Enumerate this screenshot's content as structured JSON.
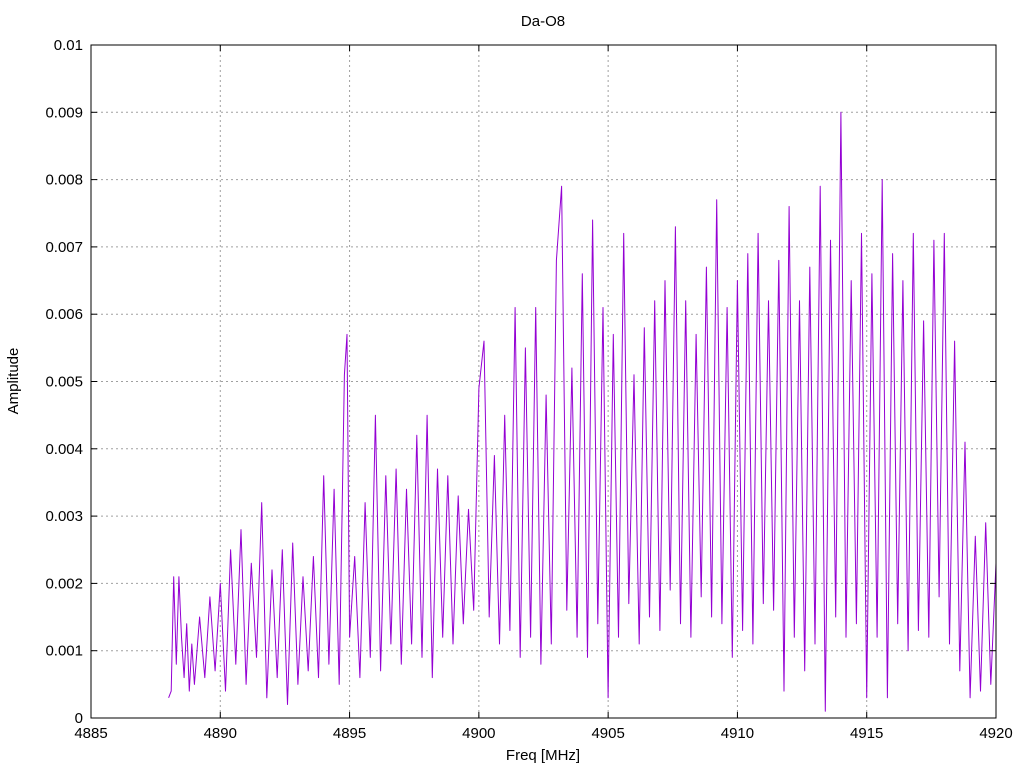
{
  "chart_data": {
    "type": "line",
    "title": "Da-O8",
    "xlabel": "Freq [MHz]",
    "ylabel": "Amplitude",
    "xlim": [
      4885,
      4920
    ],
    "ylim": [
      0,
      0.01
    ],
    "x_ticks": [
      "4885",
      "4890",
      "4895",
      "4900",
      "4905",
      "4910",
      "4915",
      "4920"
    ],
    "y_ticks": [
      "0",
      "0.001",
      "0.002",
      "0.003",
      "0.004",
      "0.005",
      "0.006",
      "0.007",
      "0.008",
      "0.009",
      "0.01"
    ],
    "grid": true,
    "series_color": "#9400d3",
    "series": [
      {
        "x": [
          4888.0,
          4888.1,
          4888.2,
          4888.3,
          4888.4,
          4888.5,
          4888.6,
          4888.7,
          4888.8,
          4888.9,
          4889.0,
          4889.2,
          4889.4,
          4889.6,
          4889.8,
          4890.0,
          4890.2,
          4890.4,
          4890.6,
          4890.8,
          4891.0,
          4891.2,
          4891.4,
          4891.6,
          4891.8,
          4892.0,
          4892.2,
          4892.4,
          4892.6,
          4892.8,
          4893.0,
          4893.2,
          4893.4,
          4893.6,
          4893.8,
          4894.0,
          4894.2,
          4894.4,
          4894.6,
          4894.8,
          4894.9,
          4895.0,
          4895.2,
          4895.4,
          4895.6,
          4895.8,
          4896.0,
          4896.2,
          4896.4,
          4896.6,
          4896.8,
          4897.0,
          4897.2,
          4897.4,
          4897.6,
          4897.8,
          4898.0,
          4898.2,
          4898.4,
          4898.6,
          4898.8,
          4899.0,
          4899.2,
          4899.4,
          4899.6,
          4899.8,
          4900.0,
          4900.2,
          4900.4,
          4900.6,
          4900.8,
          4901.0,
          4901.2,
          4901.4,
          4901.6,
          4901.8,
          4902.0,
          4902.2,
          4902.4,
          4902.6,
          4902.8,
          4903.0,
          4903.2,
          4903.4,
          4903.6,
          4903.8,
          4904.0,
          4904.2,
          4904.4,
          4904.6,
          4904.8,
          4905.0,
          4905.2,
          4905.4,
          4905.6,
          4905.8,
          4906.0,
          4906.2,
          4906.4,
          4906.6,
          4906.8,
          4907.0,
          4907.2,
          4907.4,
          4907.6,
          4907.8,
          4908.0,
          4908.2,
          4908.4,
          4908.6,
          4908.8,
          4909.0,
          4909.2,
          4909.4,
          4909.6,
          4909.8,
          4910.0,
          4910.2,
          4910.4,
          4910.6,
          4910.8,
          4911.0,
          4911.2,
          4911.4,
          4911.6,
          4911.8,
          4912.0,
          4912.2,
          4912.4,
          4912.6,
          4912.8,
          4913.0,
          4913.2,
          4913.4,
          4913.6,
          4913.8,
          4914.0,
          4914.2,
          4914.4,
          4914.6,
          4914.8,
          4915.0,
          4915.2,
          4915.4,
          4915.6,
          4915.8,
          4916.0,
          4916.2,
          4916.4,
          4916.6,
          4916.8,
          4917.0,
          4917.2,
          4917.4,
          4917.6,
          4917.8,
          4918.0,
          4918.2,
          4918.4,
          4918.6,
          4918.8,
          4919.0,
          4919.2,
          4919.4,
          4919.6,
          4919.8,
          4920.0
        ],
        "y": [
          0.0003,
          0.0004,
          0.0021,
          0.0008,
          0.0021,
          0.0012,
          0.0006,
          0.0014,
          0.0004,
          0.0011,
          0.0005,
          0.0015,
          0.0006,
          0.0018,
          0.0007,
          0.002,
          0.0004,
          0.0025,
          0.0008,
          0.0028,
          0.0005,
          0.0023,
          0.0009,
          0.0032,
          0.0003,
          0.0022,
          0.0006,
          0.0025,
          0.0002,
          0.0026,
          0.0005,
          0.0021,
          0.0007,
          0.0024,
          0.0006,
          0.0036,
          0.0008,
          0.0034,
          0.0005,
          0.0051,
          0.0057,
          0.0012,
          0.0024,
          0.0006,
          0.0032,
          0.0009,
          0.0045,
          0.0007,
          0.0036,
          0.0011,
          0.0037,
          0.0008,
          0.0034,
          0.0011,
          0.0042,
          0.0009,
          0.0045,
          0.0006,
          0.0037,
          0.0012,
          0.0036,
          0.0011,
          0.0033,
          0.0014,
          0.0031,
          0.0016,
          0.0049,
          0.0056,
          0.0015,
          0.0039,
          0.0011,
          0.0045,
          0.0013,
          0.0061,
          0.0009,
          0.0055,
          0.0012,
          0.0061,
          0.0008,
          0.0048,
          0.0011,
          0.0068,
          0.0079,
          0.0016,
          0.0052,
          0.0012,
          0.0066,
          0.0009,
          0.0074,
          0.0014,
          0.0061,
          0.0003,
          0.0057,
          0.0012,
          0.0072,
          0.0017,
          0.0051,
          0.0011,
          0.0058,
          0.0015,
          0.0062,
          0.0013,
          0.0065,
          0.0019,
          0.0073,
          0.0014,
          0.0062,
          0.0012,
          0.0057,
          0.0018,
          0.0067,
          0.0015,
          0.0077,
          0.0014,
          0.0061,
          0.0009,
          0.0065,
          0.0013,
          0.0069,
          0.0011,
          0.0072,
          0.0017,
          0.0062,
          0.0016,
          0.0068,
          0.0004,
          0.0076,
          0.0012,
          0.0062,
          0.0007,
          0.0067,
          0.0011,
          0.0079,
          0.0001,
          0.0071,
          0.0015,
          0.009,
          0.0012,
          0.0065,
          0.0014,
          0.0072,
          0.0003,
          0.0066,
          0.0012,
          0.008,
          0.0003,
          0.0069,
          0.0014,
          0.0065,
          0.001,
          0.0072,
          0.0013,
          0.0059,
          0.0012,
          0.0071,
          0.0018,
          0.0072,
          0.0011,
          0.0056,
          0.0007,
          0.0041,
          0.0003,
          0.0027,
          0.0004,
          0.0029,
          0.0005,
          0.0023
        ]
      }
    ]
  }
}
